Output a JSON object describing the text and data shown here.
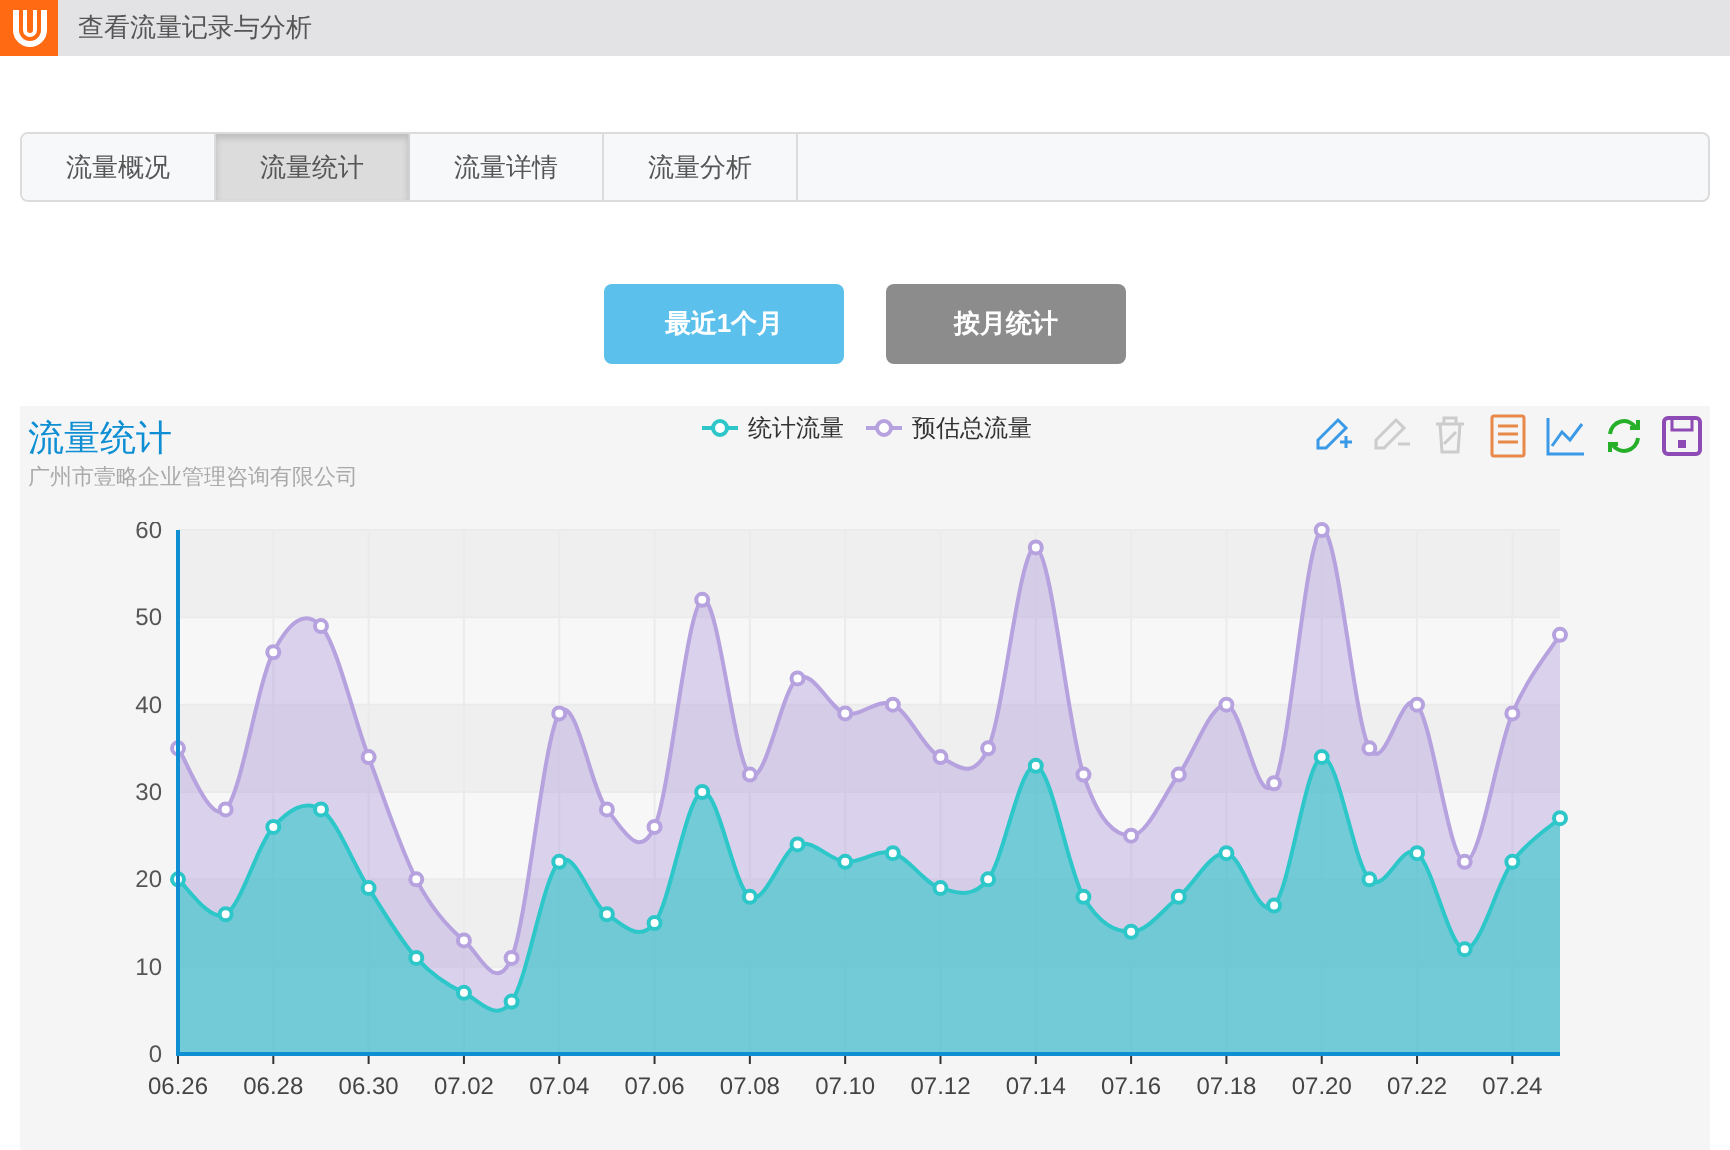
{
  "header": {
    "title": "查看流量记录与分析"
  },
  "tabs": [
    {
      "label": "流量概况",
      "selected": false
    },
    {
      "label": "流量统计",
      "selected": true
    },
    {
      "label": "流量详情",
      "selected": false
    },
    {
      "label": "流量分析",
      "selected": false
    }
  ],
  "buttons": [
    {
      "label": "最近1个月",
      "selected": true
    },
    {
      "label": "按月统计",
      "selected": false
    }
  ],
  "chart_panel": {
    "title": "流量统计",
    "subtitle": "广州市壹略企业管理咨询有限公司",
    "toolbar": [
      {
        "kind": "add",
        "disabled": false
      },
      {
        "kind": "remove",
        "disabled": true
      },
      {
        "kind": "clear",
        "disabled": true
      },
      {
        "kind": "data",
        "disabled": false
      },
      {
        "kind": "line",
        "disabled": false
      },
      {
        "kind": "refresh",
        "disabled": false
      },
      {
        "kind": "save",
        "disabled": false
      }
    ],
    "chart_data": {
      "type": "area",
      "categories": [
        "06.26",
        null,
        "06.28",
        null,
        "06.30",
        null,
        "07.02",
        null,
        "07.04",
        null,
        "07.06",
        null,
        "07.08",
        null,
        "07.10",
        null,
        "07.12",
        null,
        "07.14",
        null,
        "07.16",
        null,
        "07.18",
        null,
        "07.20",
        null,
        "07.22",
        null,
        "07.24",
        null
      ],
      "ylim": [
        0,
        60
      ],
      "yticks": [
        0,
        10,
        20,
        30,
        40,
        50,
        60
      ],
      "grid": true,
      "series": [
        {
          "name": "统计流量",
          "color": "#2ec7c9",
          "values": [
            20,
            16,
            26,
            28,
            19,
            11,
            7,
            6,
            22,
            16,
            15,
            30,
            18,
            24,
            22,
            23,
            19,
            20,
            33,
            18,
            14,
            18,
            23,
            17,
            34,
            20,
            23,
            12,
            22,
            27
          ]
        },
        {
          "name": "预估总流量",
          "color": "#b6a2de",
          "values": [
            35,
            28,
            46,
            49,
            34,
            20,
            13,
            11,
            39,
            28,
            26,
            52,
            32,
            43,
            39,
            40,
            34,
            35,
            58,
            32,
            25,
            32,
            40,
            31,
            60,
            35,
            40,
            22,
            39,
            48
          ]
        }
      ]
    }
  }
}
